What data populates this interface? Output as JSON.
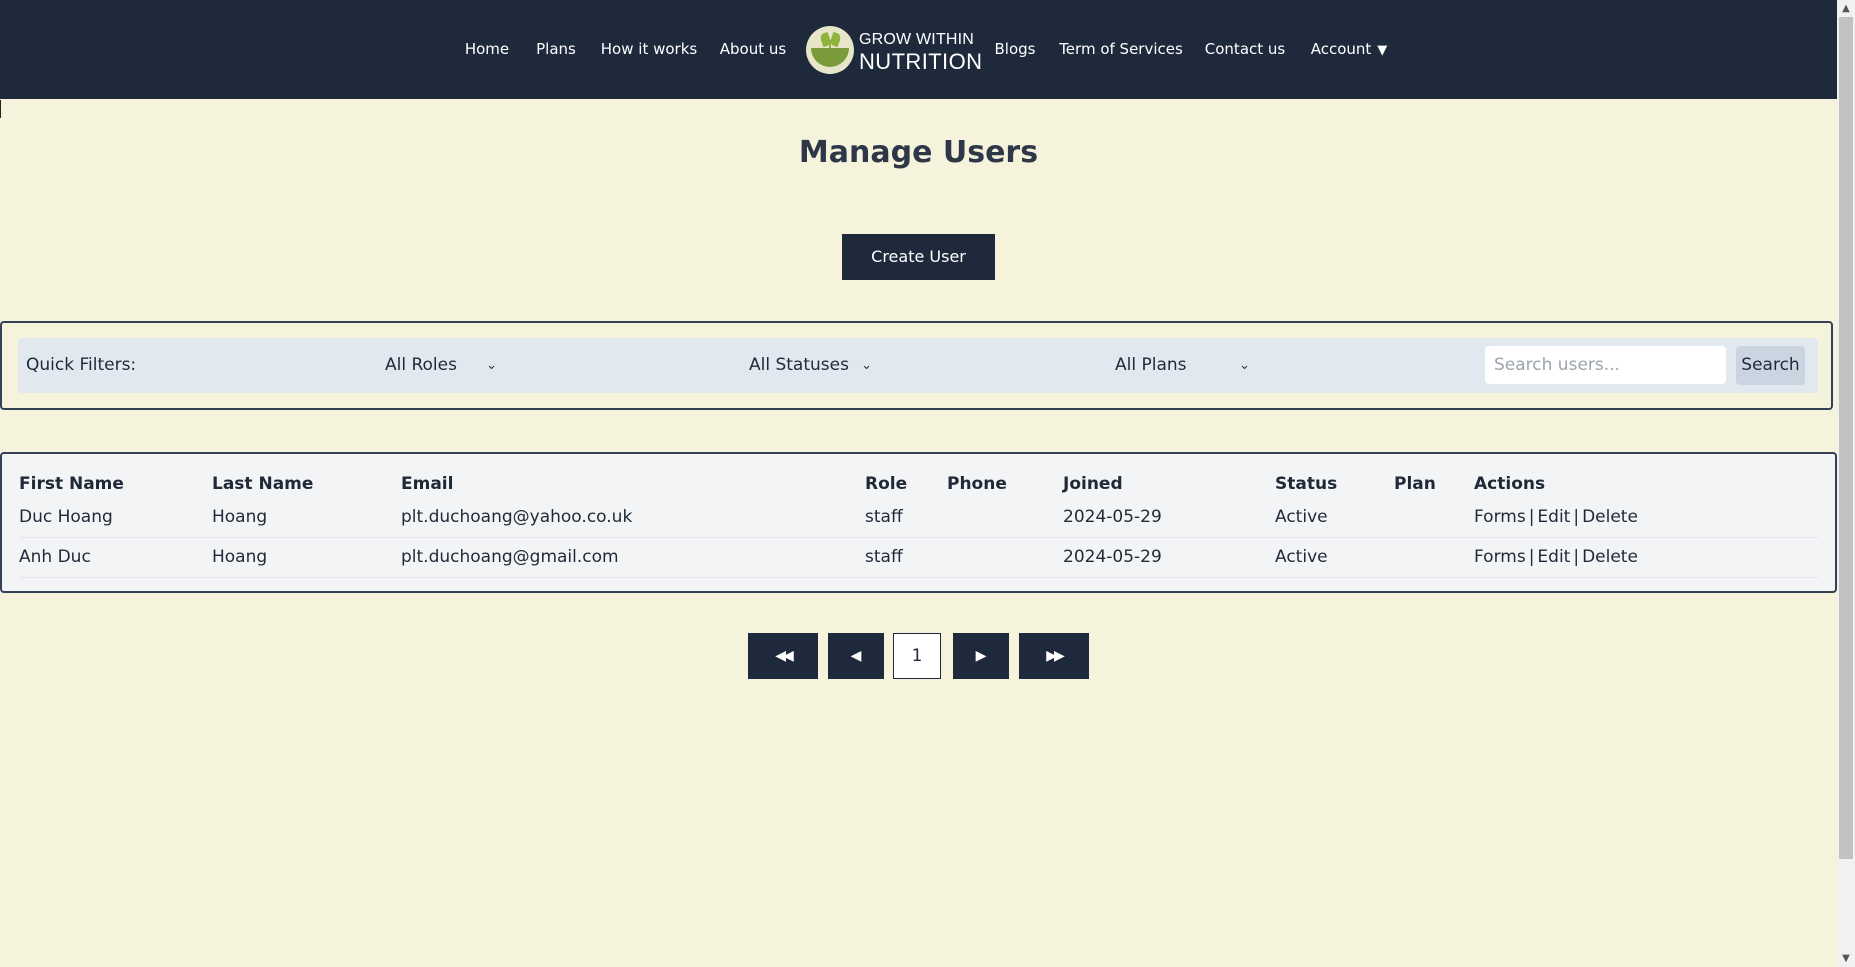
{
  "nav": {
    "left_items": [
      "Home",
      "Plans",
      "How it works",
      "About us"
    ],
    "right_items": [
      "Blogs",
      "Term of Services",
      "Contact us"
    ],
    "account_label": "Account",
    "account_caret": "▼",
    "logo": {
      "line1": "GROW WITHIN",
      "line2": "NUTRITION"
    }
  },
  "page": {
    "title": "Manage Users",
    "create_label": "Create User"
  },
  "filters": {
    "label": "Quick Filters:",
    "roles": "All Roles",
    "statuses": "All Statuses",
    "plans": "All Plans",
    "search_placeholder": "Search users...",
    "search_label": "Search"
  },
  "table": {
    "headers": [
      "First Name",
      "Last Name",
      "Email",
      "Role",
      "Phone",
      "Joined",
      "Status",
      "Plan",
      "Actions"
    ],
    "rows": [
      {
        "first": "Duc Hoang",
        "last": "Hoang",
        "email": "plt.duchoang@yahoo.co.uk",
        "role": "staff",
        "phone": "",
        "joined": "2024-05-29",
        "status": "Active",
        "plan": ""
      },
      {
        "first": "Anh Duc",
        "last": "Hoang",
        "email": "plt.duchoang@gmail.com",
        "role": "staff",
        "phone": "",
        "joined": "2024-05-29",
        "status": "Active",
        "plan": ""
      }
    ],
    "actions": {
      "forms": "Forms",
      "edit": "Edit",
      "delete": "Delete",
      "separator": "|"
    }
  },
  "pagination": {
    "first": "◀◀",
    "prev": "◀",
    "current": "1",
    "next": "▶",
    "last": "▶▶"
  },
  "colors": {
    "nav_bg": "#1e293b",
    "page_bg": "#f5f3dc",
    "button_bg": "#1e293b"
  }
}
